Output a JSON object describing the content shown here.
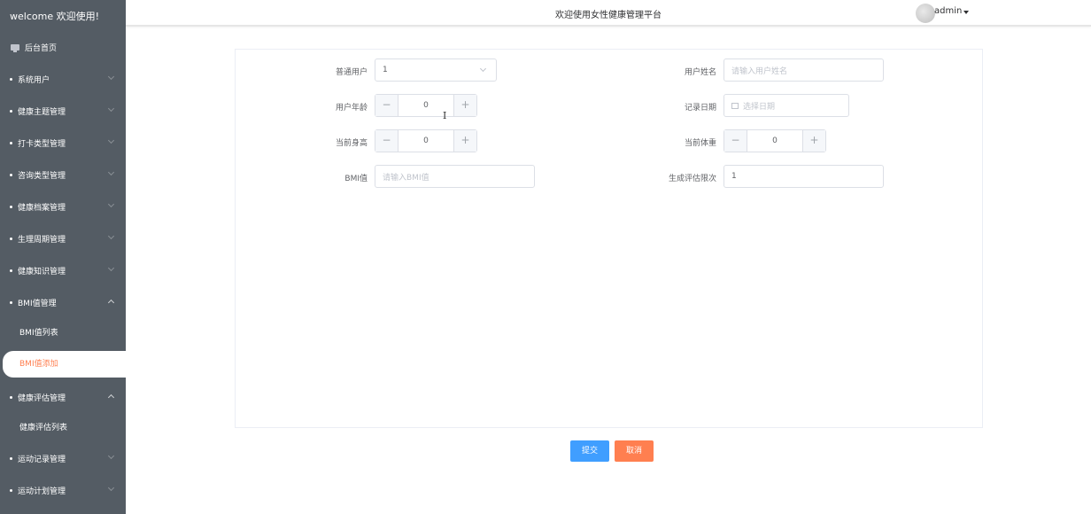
{
  "sidebar": {
    "brand": "welcome 欢迎使用!",
    "home": {
      "label": "后台首页",
      "icon": "monitor-icon"
    },
    "menus": [
      {
        "label": "系统用户",
        "expanded": false
      },
      {
        "label": "健康主题管理",
        "expanded": false
      },
      {
        "label": "打卡类型管理",
        "expanded": false
      },
      {
        "label": "咨询类型管理",
        "expanded": false
      },
      {
        "label": "健康档案管理",
        "expanded": false
      },
      {
        "label": "生理周期管理",
        "expanded": false
      },
      {
        "label": "健康知识管理",
        "expanded": false
      },
      {
        "label": "BMI值管理",
        "expanded": true
      },
      {
        "label": "健康评估管理",
        "expanded": true
      },
      {
        "label": "运动记录管理",
        "expanded": false
      },
      {
        "label": "运动计划管理",
        "expanded": false
      }
    ],
    "bmi_sub": [
      {
        "label": "BMI值列表",
        "active": false
      },
      {
        "label": "BMI值添加",
        "active": true
      }
    ],
    "assess_sub": [
      {
        "label": "健康评估列表",
        "active": false
      }
    ],
    "active_color": "#ff7f50",
    "bg_color": "#545c64"
  },
  "header": {
    "title": "欢迎使用女性健康管理平台",
    "user": "admin"
  },
  "form": {
    "user_label": "普通用户",
    "user_value": "1",
    "name_label": "用户姓名",
    "name_placeholder": "请输入用户姓名",
    "age_label": "用户年龄",
    "age_value": "0",
    "date_label": "记录日期",
    "date_placeholder": "选择日期",
    "height_label": "当前身高",
    "height_value": "0",
    "weight_label": "当前体重",
    "weight_value": "0",
    "bmi_label": "BMI值",
    "bmi_placeholder": "请输入BMI值",
    "limit_label": "生成评估限次",
    "limit_value": "1",
    "minus": "−",
    "plus": "+"
  },
  "actions": {
    "submit": "提交",
    "cancel": "取消",
    "submit_color": "#409eff",
    "cancel_color": "#ff7f50"
  }
}
